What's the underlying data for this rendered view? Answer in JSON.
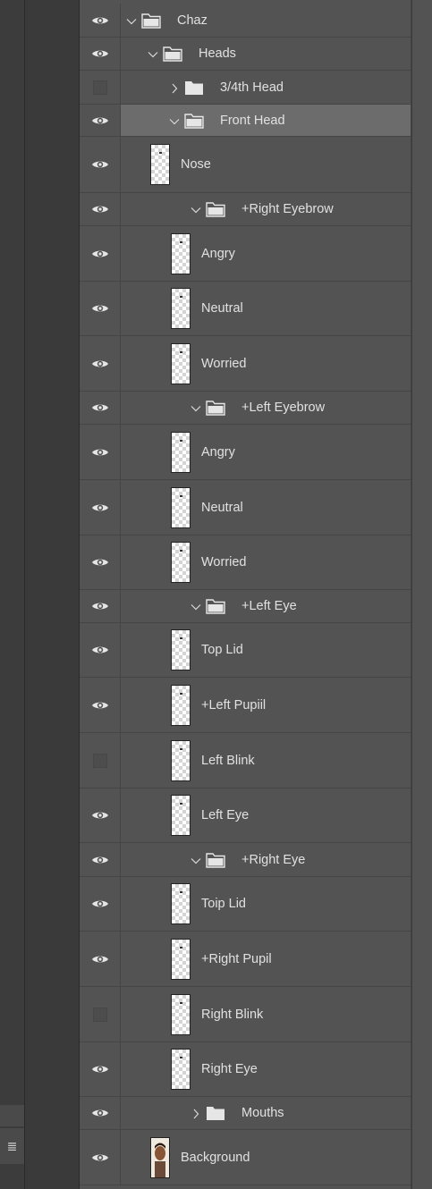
{
  "colors": {
    "panel_bg": "#535353",
    "selected_row": "#6c6c6c",
    "text": "#e1e1e1",
    "divider": "#454545"
  },
  "layers": [
    {
      "name": "Chaz",
      "type": "group",
      "expanded": true,
      "visible": true,
      "level": 0
    },
    {
      "name": "Heads",
      "type": "group",
      "expanded": true,
      "visible": true,
      "level": 1
    },
    {
      "name": "3/4th Head",
      "type": "group",
      "expanded": false,
      "visible": false,
      "level": 2
    },
    {
      "name": "Front Head",
      "type": "group",
      "expanded": true,
      "visible": true,
      "level": 2,
      "selected": true
    },
    {
      "name": "Nose",
      "type": "layer",
      "visible": true,
      "level": 3
    },
    {
      "name": "+Right Eyebrow",
      "type": "group",
      "expanded": true,
      "visible": true,
      "level": 3
    },
    {
      "name": "Angry",
      "type": "layer",
      "visible": true,
      "level": 4
    },
    {
      "name": "Neutral",
      "type": "layer",
      "visible": true,
      "level": 4
    },
    {
      "name": "Worried",
      "type": "layer",
      "visible": true,
      "level": 4
    },
    {
      "name": "+Left Eyebrow",
      "type": "group",
      "expanded": true,
      "visible": true,
      "level": 3
    },
    {
      "name": "Angry",
      "type": "layer",
      "visible": true,
      "level": 4
    },
    {
      "name": "Neutral",
      "type": "layer",
      "visible": true,
      "level": 4
    },
    {
      "name": "Worried",
      "type": "layer",
      "visible": true,
      "level": 4
    },
    {
      "name": "+Left Eye",
      "type": "group",
      "expanded": true,
      "visible": true,
      "level": 3
    },
    {
      "name": "Top Lid",
      "type": "layer",
      "visible": true,
      "level": 4
    },
    {
      "name": "+Left Pupiil",
      "type": "layer",
      "visible": true,
      "level": 4
    },
    {
      "name": "Left Blink",
      "type": "layer",
      "visible": false,
      "level": 4
    },
    {
      "name": "Left Eye",
      "type": "layer",
      "visible": true,
      "level": 4
    },
    {
      "name": "+Right Eye",
      "type": "group",
      "expanded": true,
      "visible": true,
      "level": 3
    },
    {
      "name": "Toip Lid",
      "type": "layer",
      "visible": true,
      "level": 4
    },
    {
      "name": "+Right Pupil",
      "type": "layer",
      "visible": true,
      "level": 4
    },
    {
      "name": "Right Blink",
      "type": "layer",
      "visible": false,
      "level": 4
    },
    {
      "name": "Right Eye",
      "type": "layer",
      "visible": true,
      "level": 4
    },
    {
      "name": "Mouths",
      "type": "group",
      "expanded": false,
      "visible": true,
      "level": 3
    },
    {
      "name": "Background",
      "type": "layer",
      "visible": true,
      "level": 2,
      "thumbnail": "portrait"
    }
  ]
}
